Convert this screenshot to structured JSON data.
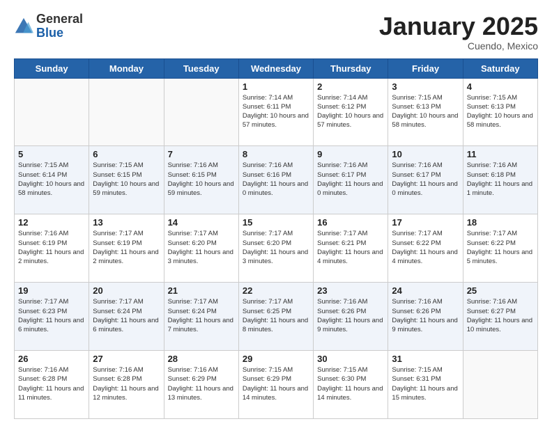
{
  "logo": {
    "general": "General",
    "blue": "Blue"
  },
  "header": {
    "month": "January 2025",
    "location": "Cuendo, Mexico"
  },
  "weekdays": [
    "Sunday",
    "Monday",
    "Tuesday",
    "Wednesday",
    "Thursday",
    "Friday",
    "Saturday"
  ],
  "weeks": [
    [
      {
        "day": "",
        "info": ""
      },
      {
        "day": "",
        "info": ""
      },
      {
        "day": "",
        "info": ""
      },
      {
        "day": "1",
        "info": "Sunrise: 7:14 AM\nSunset: 6:11 PM\nDaylight: 10 hours and 57 minutes."
      },
      {
        "day": "2",
        "info": "Sunrise: 7:14 AM\nSunset: 6:12 PM\nDaylight: 10 hours and 57 minutes."
      },
      {
        "day": "3",
        "info": "Sunrise: 7:15 AM\nSunset: 6:13 PM\nDaylight: 10 hours and 58 minutes."
      },
      {
        "day": "4",
        "info": "Sunrise: 7:15 AM\nSunset: 6:13 PM\nDaylight: 10 hours and 58 minutes."
      }
    ],
    [
      {
        "day": "5",
        "info": "Sunrise: 7:15 AM\nSunset: 6:14 PM\nDaylight: 10 hours and 58 minutes."
      },
      {
        "day": "6",
        "info": "Sunrise: 7:15 AM\nSunset: 6:15 PM\nDaylight: 10 hours and 59 minutes."
      },
      {
        "day": "7",
        "info": "Sunrise: 7:16 AM\nSunset: 6:15 PM\nDaylight: 10 hours and 59 minutes."
      },
      {
        "day": "8",
        "info": "Sunrise: 7:16 AM\nSunset: 6:16 PM\nDaylight: 11 hours and 0 minutes."
      },
      {
        "day": "9",
        "info": "Sunrise: 7:16 AM\nSunset: 6:17 PM\nDaylight: 11 hours and 0 minutes."
      },
      {
        "day": "10",
        "info": "Sunrise: 7:16 AM\nSunset: 6:17 PM\nDaylight: 11 hours and 0 minutes."
      },
      {
        "day": "11",
        "info": "Sunrise: 7:16 AM\nSunset: 6:18 PM\nDaylight: 11 hours and 1 minute."
      }
    ],
    [
      {
        "day": "12",
        "info": "Sunrise: 7:16 AM\nSunset: 6:19 PM\nDaylight: 11 hours and 2 minutes."
      },
      {
        "day": "13",
        "info": "Sunrise: 7:17 AM\nSunset: 6:19 PM\nDaylight: 11 hours and 2 minutes."
      },
      {
        "day": "14",
        "info": "Sunrise: 7:17 AM\nSunset: 6:20 PM\nDaylight: 11 hours and 3 minutes."
      },
      {
        "day": "15",
        "info": "Sunrise: 7:17 AM\nSunset: 6:20 PM\nDaylight: 11 hours and 3 minutes."
      },
      {
        "day": "16",
        "info": "Sunrise: 7:17 AM\nSunset: 6:21 PM\nDaylight: 11 hours and 4 minutes."
      },
      {
        "day": "17",
        "info": "Sunrise: 7:17 AM\nSunset: 6:22 PM\nDaylight: 11 hours and 4 minutes."
      },
      {
        "day": "18",
        "info": "Sunrise: 7:17 AM\nSunset: 6:22 PM\nDaylight: 11 hours and 5 minutes."
      }
    ],
    [
      {
        "day": "19",
        "info": "Sunrise: 7:17 AM\nSunset: 6:23 PM\nDaylight: 11 hours and 6 minutes."
      },
      {
        "day": "20",
        "info": "Sunrise: 7:17 AM\nSunset: 6:24 PM\nDaylight: 11 hours and 6 minutes."
      },
      {
        "day": "21",
        "info": "Sunrise: 7:17 AM\nSunset: 6:24 PM\nDaylight: 11 hours and 7 minutes."
      },
      {
        "day": "22",
        "info": "Sunrise: 7:17 AM\nSunset: 6:25 PM\nDaylight: 11 hours and 8 minutes."
      },
      {
        "day": "23",
        "info": "Sunrise: 7:16 AM\nSunset: 6:26 PM\nDaylight: 11 hours and 9 minutes."
      },
      {
        "day": "24",
        "info": "Sunrise: 7:16 AM\nSunset: 6:26 PM\nDaylight: 11 hours and 9 minutes."
      },
      {
        "day": "25",
        "info": "Sunrise: 7:16 AM\nSunset: 6:27 PM\nDaylight: 11 hours and 10 minutes."
      }
    ],
    [
      {
        "day": "26",
        "info": "Sunrise: 7:16 AM\nSunset: 6:28 PM\nDaylight: 11 hours and 11 minutes."
      },
      {
        "day": "27",
        "info": "Sunrise: 7:16 AM\nSunset: 6:28 PM\nDaylight: 11 hours and 12 minutes."
      },
      {
        "day": "28",
        "info": "Sunrise: 7:16 AM\nSunset: 6:29 PM\nDaylight: 11 hours and 13 minutes."
      },
      {
        "day": "29",
        "info": "Sunrise: 7:15 AM\nSunset: 6:29 PM\nDaylight: 11 hours and 14 minutes."
      },
      {
        "day": "30",
        "info": "Sunrise: 7:15 AM\nSunset: 6:30 PM\nDaylight: 11 hours and 14 minutes."
      },
      {
        "day": "31",
        "info": "Sunrise: 7:15 AM\nSunset: 6:31 PM\nDaylight: 11 hours and 15 minutes."
      },
      {
        "day": "",
        "info": ""
      }
    ]
  ]
}
